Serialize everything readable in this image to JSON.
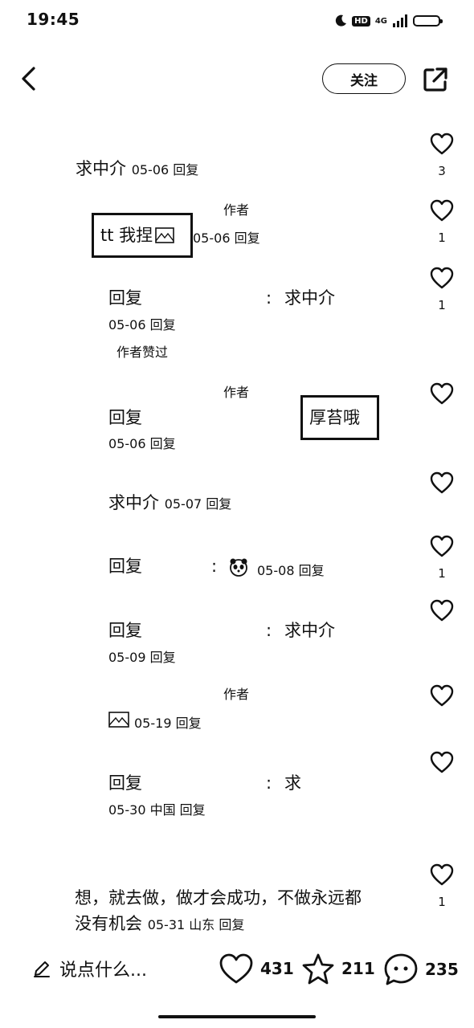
{
  "status_bar": {
    "time": "19:45",
    "hd": "HD",
    "network": "4G"
  },
  "header": {
    "follow_label": "关注"
  },
  "comments": [
    {
      "name": "求中介",
      "meta": "05-06 回复",
      "likes": "3"
    },
    {
      "author_tag": "作者",
      "name": "tt 我捏",
      "meta": "05-06 回复",
      "likes": "1"
    },
    {
      "prefix": "回复",
      "colon": ":",
      "content": "求中介",
      "meta": "05-06 回复",
      "liked_by_author": "作者赞过",
      "likes": "1"
    },
    {
      "author_tag": "作者",
      "prefix": "回复",
      "boxed_name": "厚苔哦",
      "meta": "05-06 回复",
      "likes": ""
    },
    {
      "name": "求中介",
      "meta": "05-07 回复",
      "likes": ""
    },
    {
      "prefix": "回复",
      "colon": ":",
      "meta": "05-08 回复",
      "likes": "1"
    },
    {
      "prefix": "回复",
      "colon": ":",
      "content": "求中介",
      "meta": "05-09 回复",
      "likes": ""
    },
    {
      "author_tag": "作者",
      "meta": "05-19 回复",
      "likes": ""
    },
    {
      "prefix": "回复",
      "colon": ":",
      "content": "求",
      "meta": "05-30 中国 回复",
      "likes": ""
    },
    {
      "line1": "想，就去做，做才会成功，不做永远都",
      "line2": "没有机会",
      "meta": "05-31 山东 回复",
      "likes": "1"
    }
  ],
  "bottom_bar": {
    "placeholder": "说点什么...",
    "like_count": "431",
    "star_count": "211",
    "comment_count": "235"
  }
}
